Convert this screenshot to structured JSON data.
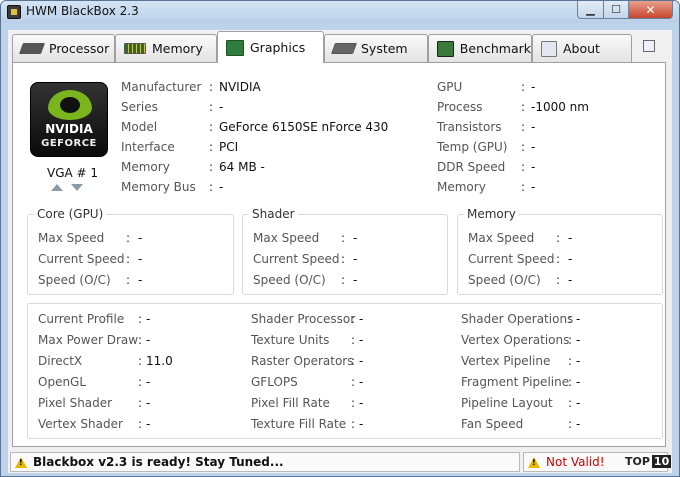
{
  "window": {
    "title": "HWM BlackBox 2.3"
  },
  "tabs": [
    {
      "label": "Processor",
      "icon": "cpu-chip-icon"
    },
    {
      "label": "Memory",
      "icon": "memory-module-icon"
    },
    {
      "label": "Graphics",
      "icon": "graphics-card-icon"
    },
    {
      "label": "System",
      "icon": "system-board-icon"
    },
    {
      "label": "Benchmark",
      "icon": "benchmark-icon"
    },
    {
      "label": "About",
      "icon": "about-icon"
    }
  ],
  "active_tab": "Graphics",
  "logo": {
    "brand": "NVIDIA",
    "line": "GEFORCE"
  },
  "vga": {
    "label": "VGA # 1"
  },
  "info_left": [
    {
      "label": "Manufacturer",
      "value": "NVIDIA"
    },
    {
      "label": "Series",
      "value": "-"
    },
    {
      "label": "Model",
      "value": "GeForce 6150SE nForce 430"
    },
    {
      "label": "Interface",
      "value": "PCI"
    },
    {
      "label": "Memory",
      "value": "64 MB -"
    },
    {
      "label": "Memory Bus",
      "value": "-"
    }
  ],
  "info_right": [
    {
      "label": "GPU",
      "value": "-"
    },
    {
      "label": "Process",
      "value": "-1000 nm"
    },
    {
      "label": "Transistors",
      "value": "-"
    },
    {
      "label": "Temp (GPU)",
      "value": "-"
    },
    {
      "label": "DDR Speed",
      "value": "-"
    },
    {
      "label": "Memory",
      "value": "-"
    }
  ],
  "groups": [
    {
      "title": "Core (GPU)",
      "rows": [
        {
          "label": "Max Speed",
          "value": "-"
        },
        {
          "label": "Current Speed",
          "value": "-"
        },
        {
          "label": "Speed (O/C)",
          "value": "-"
        }
      ]
    },
    {
      "title": "Shader",
      "rows": [
        {
          "label": "Max Speed",
          "value": "-"
        },
        {
          "label": "Current Speed",
          "value": "-"
        },
        {
          "label": "Speed (O/C)",
          "value": "-"
        }
      ]
    },
    {
      "title": "Memory",
      "rows": [
        {
          "label": "Max Speed",
          "value": "-"
        },
        {
          "label": "Current Speed",
          "value": "-"
        },
        {
          "label": "Speed (O/C)",
          "value": "-"
        }
      ]
    }
  ],
  "details": [
    [
      {
        "label": "Current Profile",
        "value": "-"
      },
      {
        "label": "Max Power Draw",
        "value": "-"
      },
      {
        "label": "DirectX",
        "value": "11.0"
      },
      {
        "label": "OpenGL",
        "value": "-"
      },
      {
        "label": "Pixel Shader",
        "value": "-"
      },
      {
        "label": "Vertex Shader",
        "value": "-"
      }
    ],
    [
      {
        "label": "Shader Processor",
        "value": "-"
      },
      {
        "label": "Texture Units",
        "value": "-"
      },
      {
        "label": "Raster Operators",
        "value": "-"
      },
      {
        "label": "GFLOPS",
        "value": "-"
      },
      {
        "label": "Pixel Fill Rate",
        "value": "-"
      },
      {
        "label": "Texture Fill Rate",
        "value": "-"
      }
    ],
    [
      {
        "label": "Shader Operations",
        "value": "-"
      },
      {
        "label": "Vertex Operations",
        "value": "-"
      },
      {
        "label": "Vertex Pipeline",
        "value": "-"
      },
      {
        "label": "Fragment Pipeline",
        "value": "-"
      },
      {
        "label": "Pipeline Layout",
        "value": "-"
      },
      {
        "label": "Fan Speed",
        "value": "-"
      }
    ]
  ],
  "status": {
    "message": "Blackbox v2.3 is ready! Stay Tuned...",
    "validity": "Not Valid!",
    "badge_text": "TOP",
    "badge_num": "10",
    "validity_color": "#cc0000"
  }
}
